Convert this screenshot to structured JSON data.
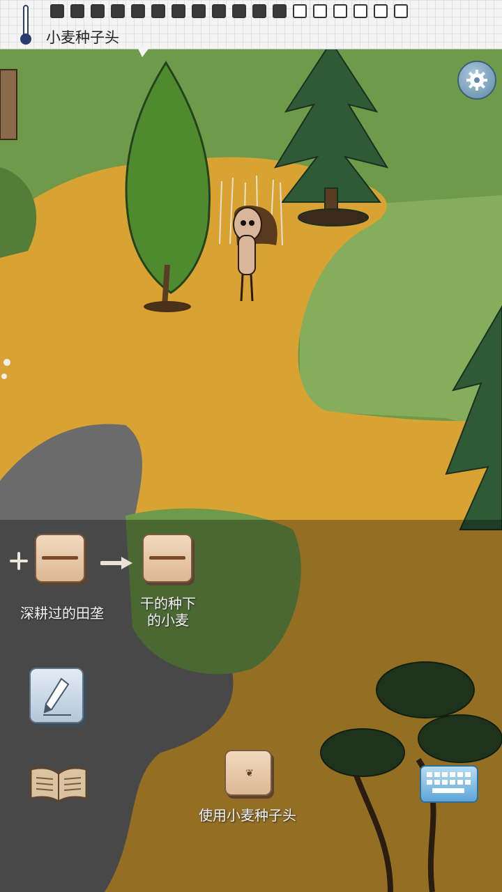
{
  "hud": {
    "hover_object_label": "小麦种子头",
    "food": {
      "filled": 12,
      "total": 18
    },
    "icons": [
      "thermometer-icon",
      "settings-gear-icon",
      "pencil-icon",
      "recipe-book-icon",
      "keyboard-icon"
    ]
  },
  "hint": {
    "source_label": "深耕过的田垄",
    "result_label_line1": "干的种下",
    "result_label_line2": "的小麦",
    "action_label": "使用小麦种子头"
  },
  "colors": {
    "grass": "#6f9a4a",
    "dry_ground": "#d9a334",
    "ash": "#6b6b6b",
    "pine": "#2f5a36",
    "tile": "#e8c8a6"
  }
}
